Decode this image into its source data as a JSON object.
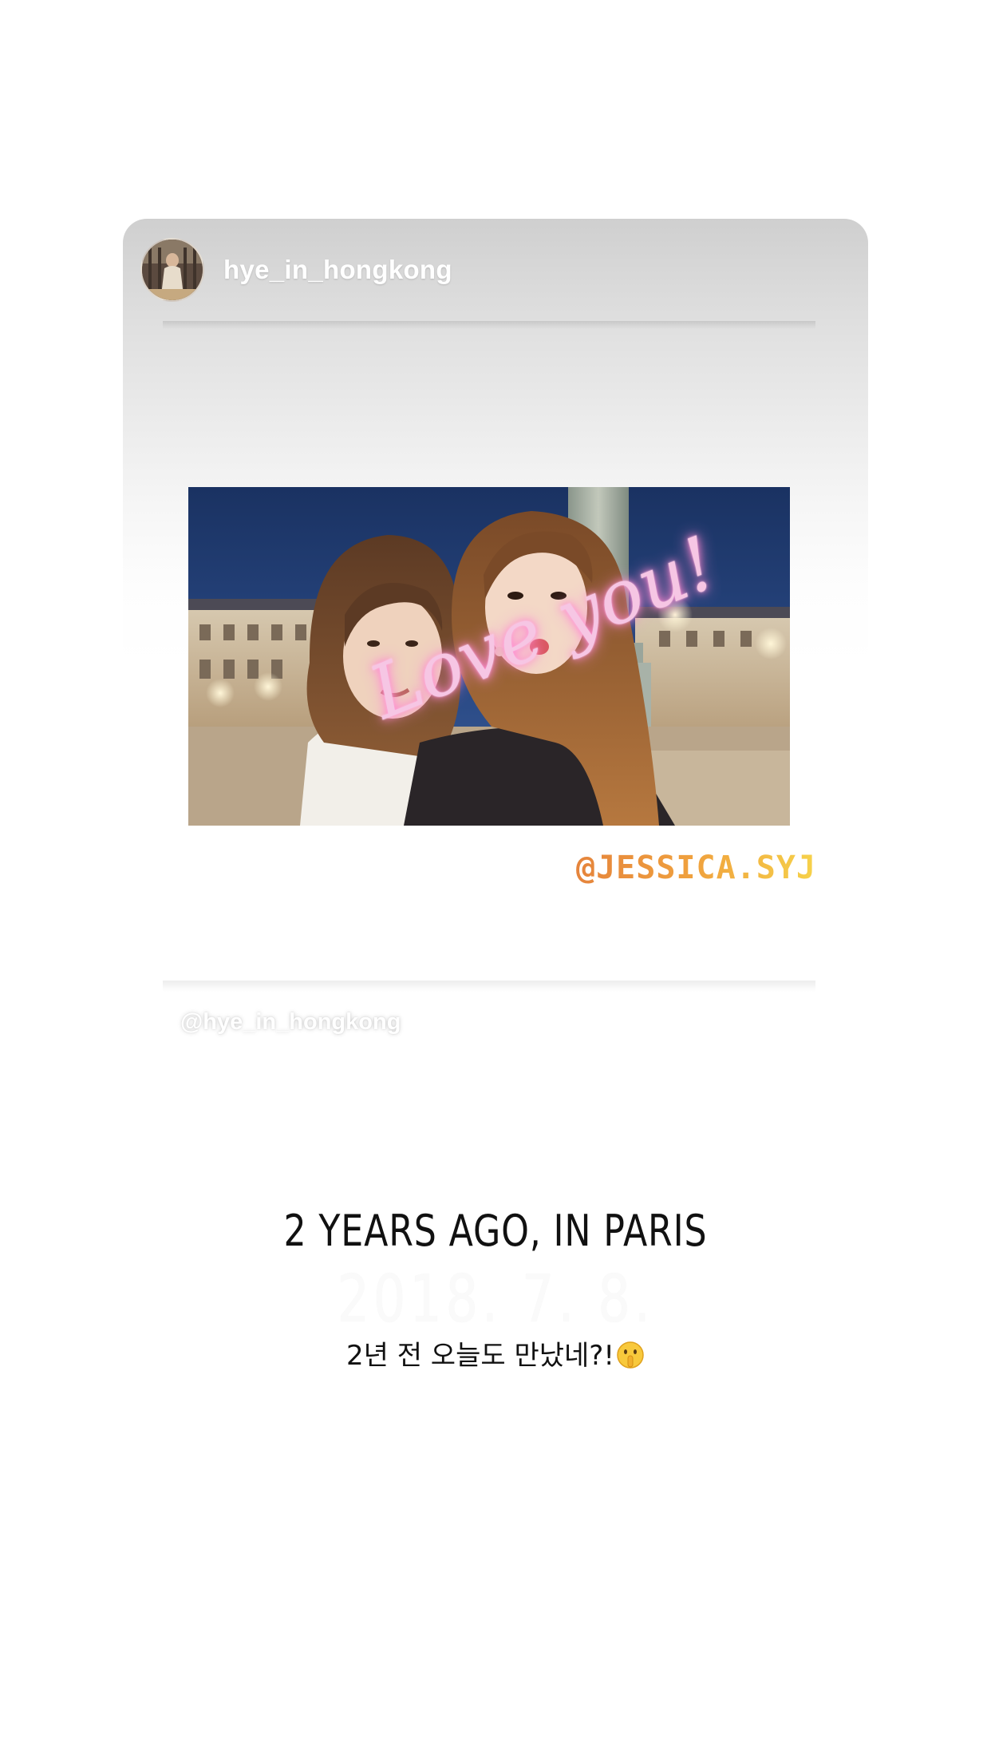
{
  "story": {
    "username": "hye_in_hongkong",
    "watermark": "@hye_in_hongkong"
  },
  "stickers": {
    "handwriting": "Love you!",
    "mention": "@JESSICA.SYJ"
  },
  "captions": {
    "title": "2 YEARS AGO, IN PARIS",
    "date": "2018. 7. 8.",
    "korean": "2년 전 오늘도 만났네?!"
  },
  "icons": {
    "avatar": "profile-avatar",
    "emoji": "shushing-face-emoji"
  },
  "colors": {
    "sticker_pink": "#f6c6e4",
    "mention_gradient_start": "#e5843c",
    "mention_gradient_end": "#f6d24a",
    "sky": "#1e3766"
  }
}
